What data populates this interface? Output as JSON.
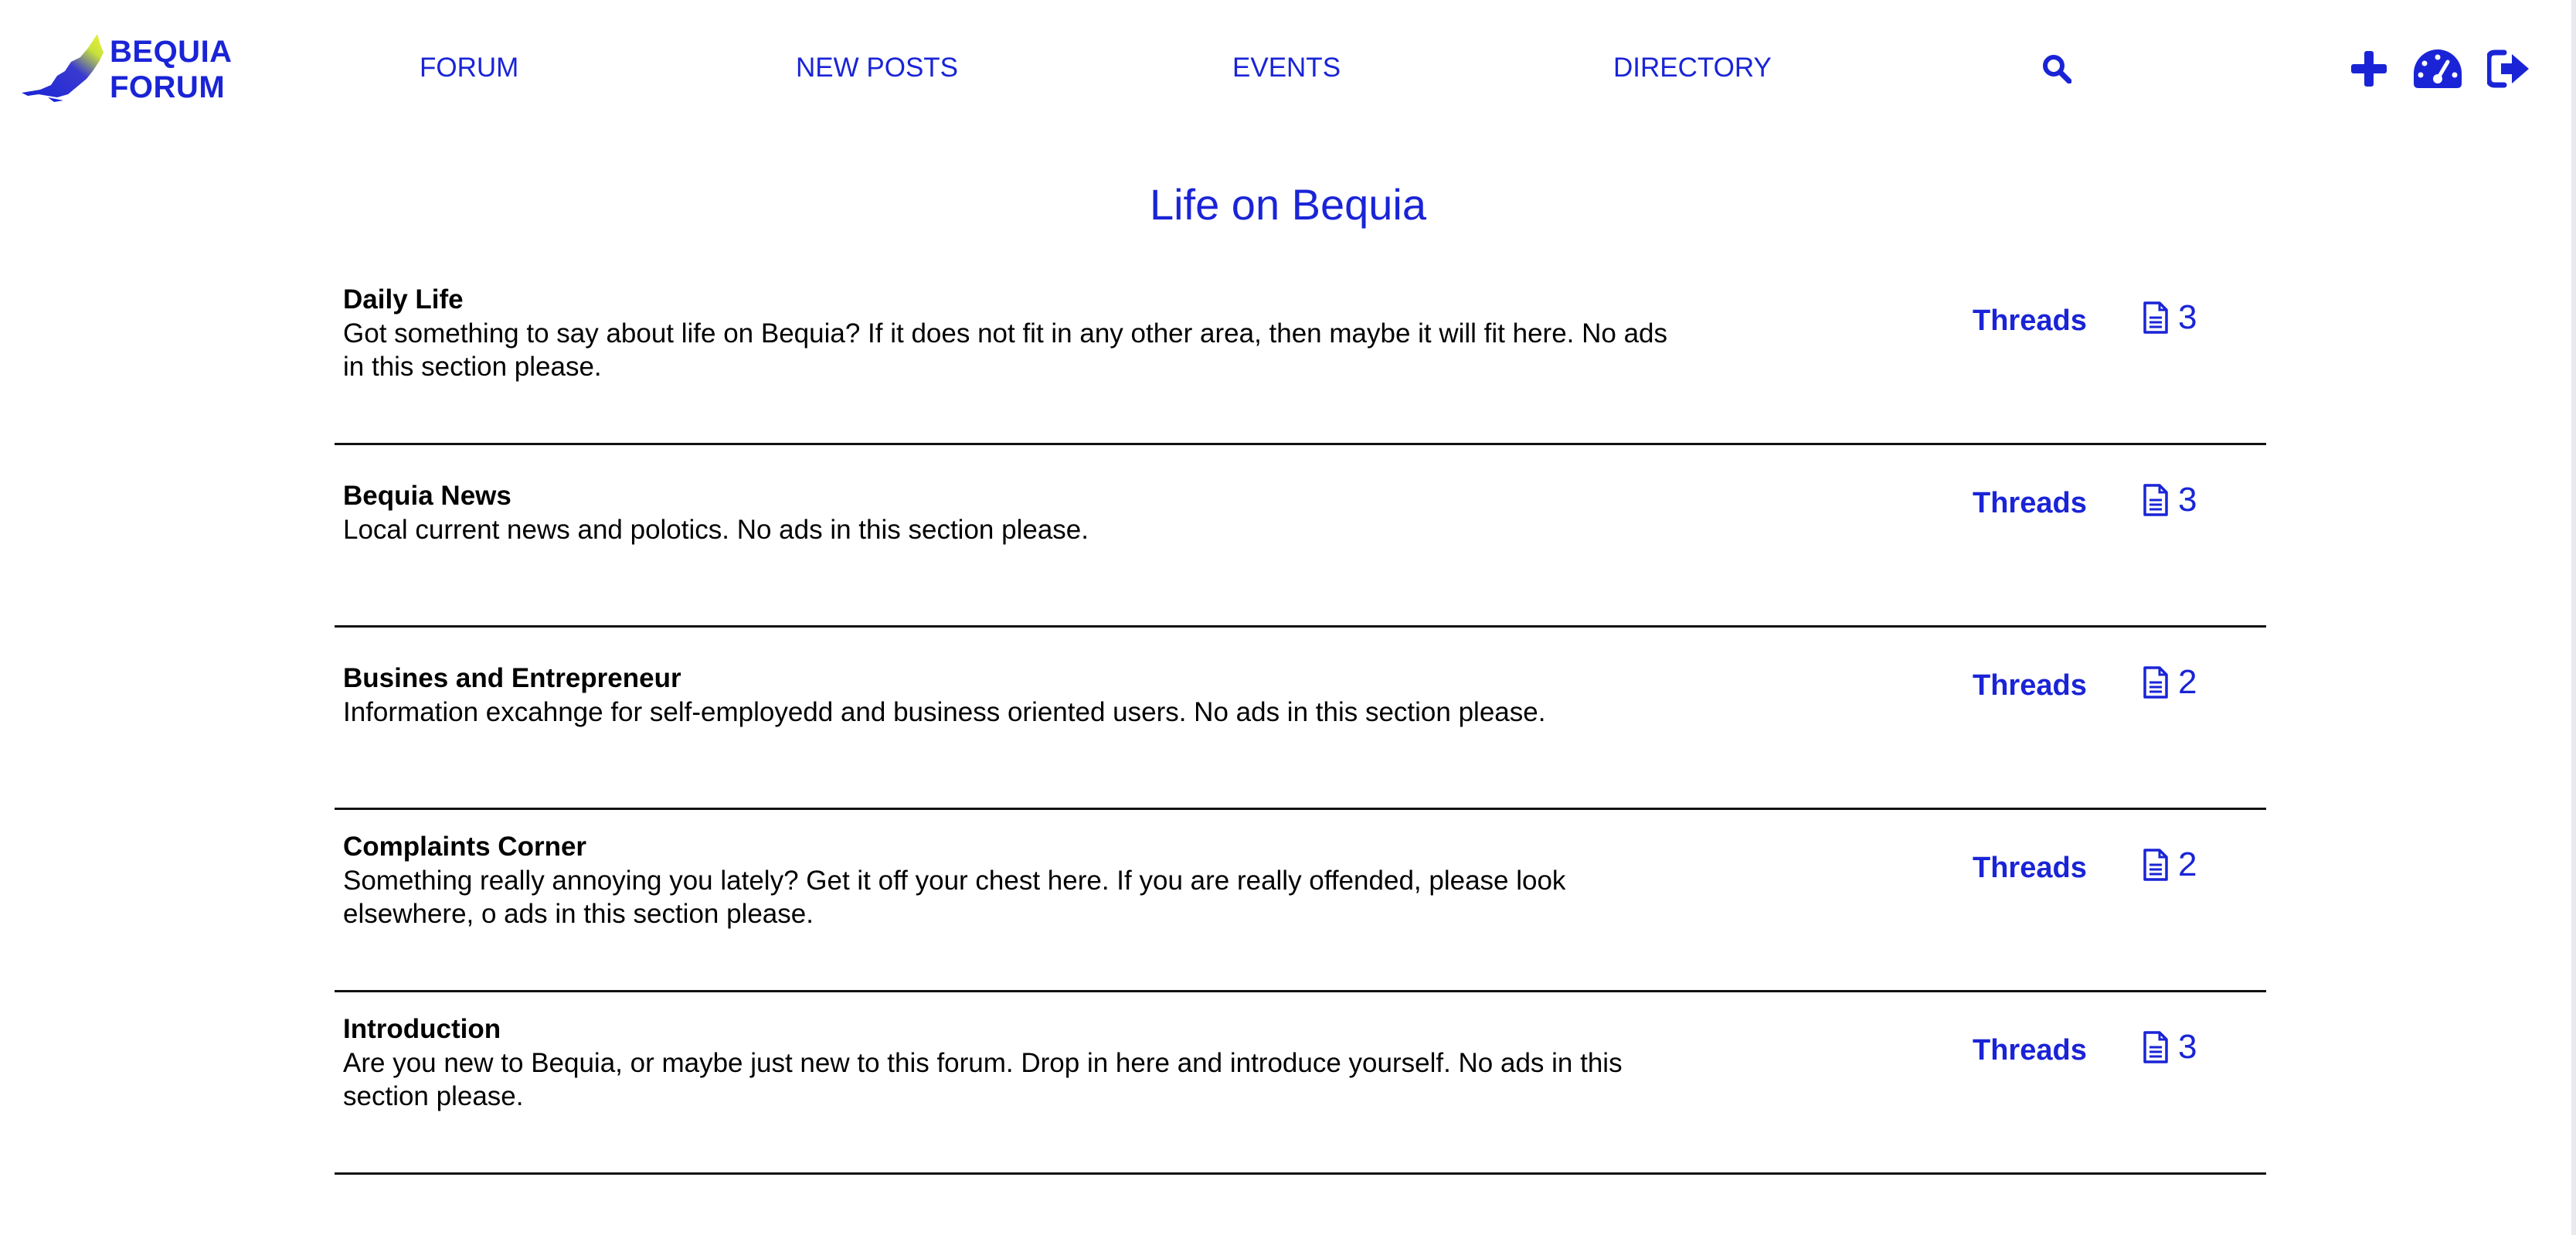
{
  "brand": {
    "line1": "BEQUIA",
    "line2": "FORUM"
  },
  "nav": {
    "forum": "FORUM",
    "new_posts": "NEW POSTS",
    "events": "EVENTS",
    "directory": "DIRECTORY"
  },
  "icons": {
    "search": "search-icon",
    "add": "plus-icon",
    "dashboard": "dashboard-icon",
    "logout": "logout-icon",
    "thread_count": "document-icon"
  },
  "colors": {
    "accent": "#1a24d6",
    "text": "#000000",
    "divider": "#111111"
  },
  "page_title": "Life on Bequia",
  "forums": [
    {
      "title": "Daily Life",
      "description": "Got something to say about life on Bequia? If it does not fit in any other area, then maybe it will fit here. No ads in this section please.",
      "threads_label": "Threads",
      "count": "3"
    },
    {
      "title": "Bequia News",
      "description": "Local current news and polotics. No ads in this section please.",
      "threads_label": "Threads",
      "count": "3"
    },
    {
      "title": "Busines and Entrepreneur",
      "description": "Information excahnge for self-employedd and business oriented users. No ads in this section please.",
      "threads_label": "Threads",
      "count": "2"
    },
    {
      "title": "Complaints Corner",
      "description": "Something really annoying you lately? Get it off your chest here. If you are really offended, please look elsewhere, o ads in this section please.",
      "threads_label": "Threads",
      "count": "2"
    },
    {
      "title": "Introduction",
      "description": "Are you new to Bequia, or maybe just new to this forum. Drop in here and introduce yourself. No ads in this section please.",
      "threads_label": "Threads",
      "count": "3"
    }
  ]
}
